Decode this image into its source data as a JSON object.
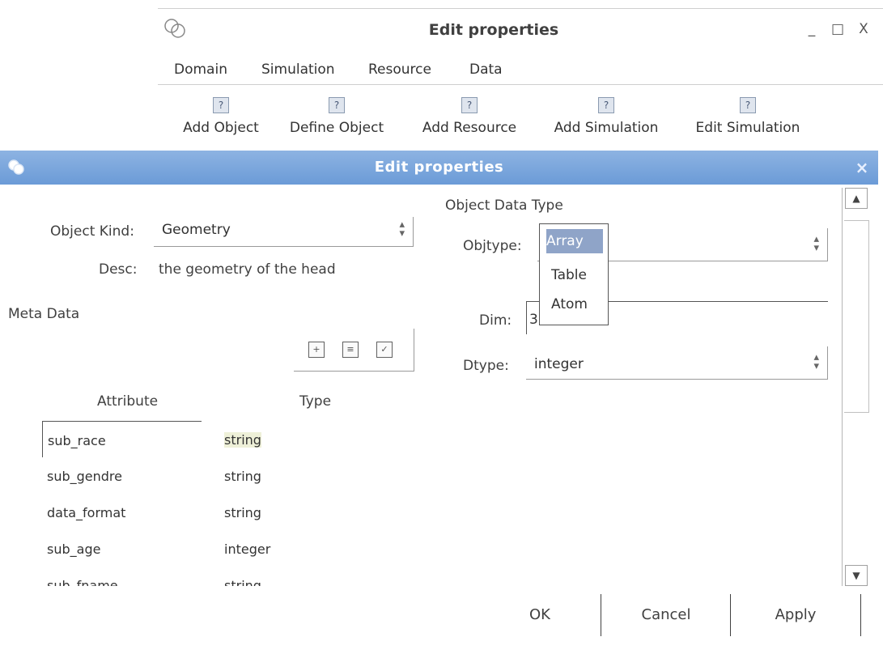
{
  "back_window": {
    "title": "Edit properties",
    "controls": {
      "minimize": "_",
      "maximize": "□",
      "close": "X"
    },
    "menu": [
      "Domain",
      "Simulation",
      "Resource",
      "Data"
    ],
    "toolbar": [
      "Add Object",
      "Define Object",
      "Add Resource",
      "Add Simulation",
      "Edit Simulation"
    ],
    "toolbar_icon_glyph": "?"
  },
  "dialog": {
    "title": "Edit properties",
    "close": "×",
    "object_kind": {
      "label": "Object Kind:",
      "value": "Geometry"
    },
    "desc": {
      "label": "Desc:",
      "value": "the geometry of the head"
    },
    "meta_data_label": "Meta Data",
    "object_data_type": {
      "heading": "Object Data Type",
      "objtype_label": "Objtype:",
      "objtype_value": "Array",
      "objtype_options": [
        "Array",
        "Table",
        "Atom"
      ],
      "dim_label": "Dim:",
      "dim_value": "3",
      "dtype_label": "Dtype:",
      "dtype_value": "integer"
    },
    "table": {
      "headers": [
        "Attribute",
        "Type"
      ],
      "rows": [
        {
          "attribute": "sub_race",
          "type": "string"
        },
        {
          "attribute": "sub_gendre",
          "type": "string"
        },
        {
          "attribute": "data_format",
          "type": "string"
        },
        {
          "attribute": "sub_age",
          "type": "integer"
        },
        {
          "attribute": "sub_fname",
          "type": "string"
        }
      ]
    },
    "buttons": {
      "ok": "OK",
      "cancel": "Cancel",
      "apply": "Apply"
    },
    "colors": {
      "titlebar": "#7aa6de",
      "selection": "#8fa4c8"
    }
  }
}
